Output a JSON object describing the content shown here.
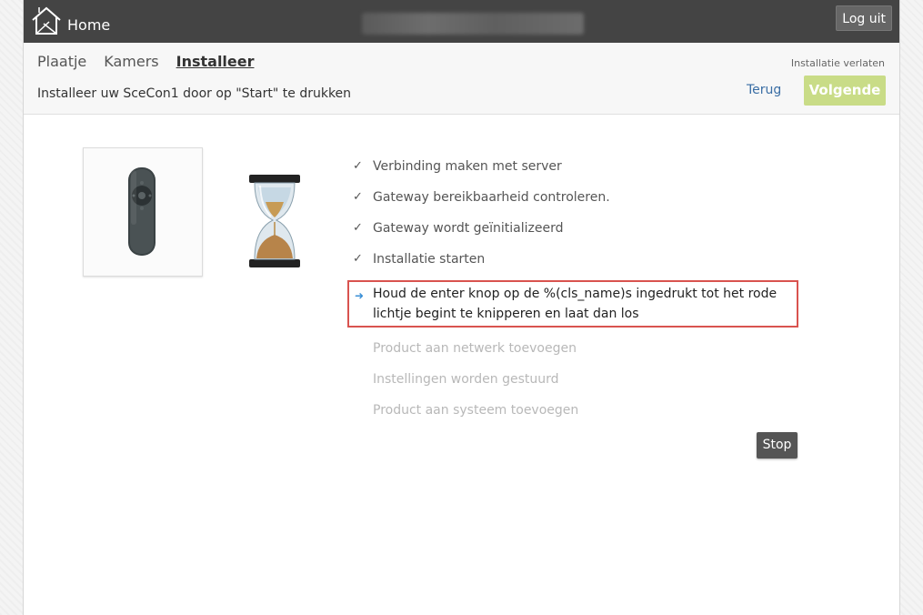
{
  "header": {
    "home_label": "Home",
    "logout_label": "Log uit"
  },
  "nav": {
    "tabs": [
      {
        "label": "Plaatje",
        "active": false
      },
      {
        "label": "Kamers",
        "active": false
      },
      {
        "label": "Installeer",
        "active": true
      }
    ],
    "leave_label": "Installatie verlaten",
    "instruction": "Installeer uw SceCon1 door op \"Start\" te drukken",
    "back_label": "Terug",
    "next_label": "Volgende"
  },
  "steps": [
    {
      "label": "Verbinding maken met server",
      "status": "done"
    },
    {
      "label": "Gateway bereikbaarheid controleren.",
      "status": "done"
    },
    {
      "label": "Gateway wordt geïnitializeerd",
      "status": "done"
    },
    {
      "label": "Installatie starten",
      "status": "done"
    },
    {
      "label": "Houd de enter knop op de %(cls_name)s ingedrukt tot het rode lichtje begint te knipperen en laat dan los",
      "status": "current"
    },
    {
      "label": "Product aan netwerk toevoegen",
      "status": "pending"
    },
    {
      "label": "Instellingen worden gestuurd",
      "status": "pending"
    },
    {
      "label": "Product aan systeem toevoegen",
      "status": "pending"
    }
  ],
  "marks": {
    "done": "✓",
    "current": "➜"
  },
  "stop_label": "Stop",
  "colors": {
    "header_bg": "#444444",
    "next_button": "#c9dc87",
    "highlight_border": "#d9534f",
    "link": "#3a6ea5"
  },
  "icons": {
    "home": "house-icon",
    "device": "remote-control-icon",
    "waiting": "hourglass-icon"
  }
}
